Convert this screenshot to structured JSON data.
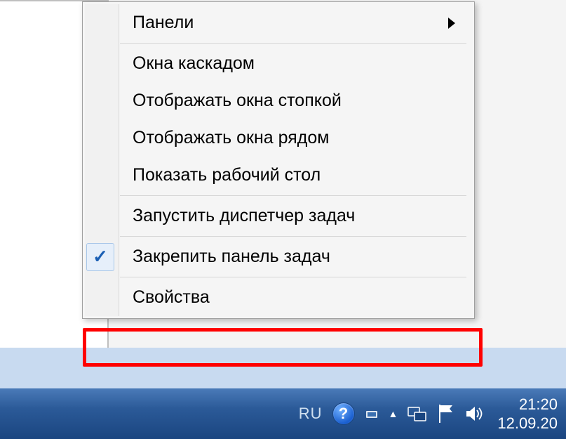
{
  "context_menu": {
    "items": [
      {
        "label": "Панели",
        "has_submenu": true
      },
      {
        "label": "Окна каскадом"
      },
      {
        "label": "Отображать окна стопкой"
      },
      {
        "label": "Отображать окна рядом"
      },
      {
        "label": "Показать рабочий стол"
      },
      {
        "label": "Запустить диспетчер задач"
      },
      {
        "label": "Закрепить панель задач",
        "checked": true
      },
      {
        "label": "Свойства",
        "highlighted": true
      }
    ]
  },
  "taskbar": {
    "language": "RU",
    "help_symbol": "?",
    "time": "21:20",
    "date": "12.09.20"
  }
}
